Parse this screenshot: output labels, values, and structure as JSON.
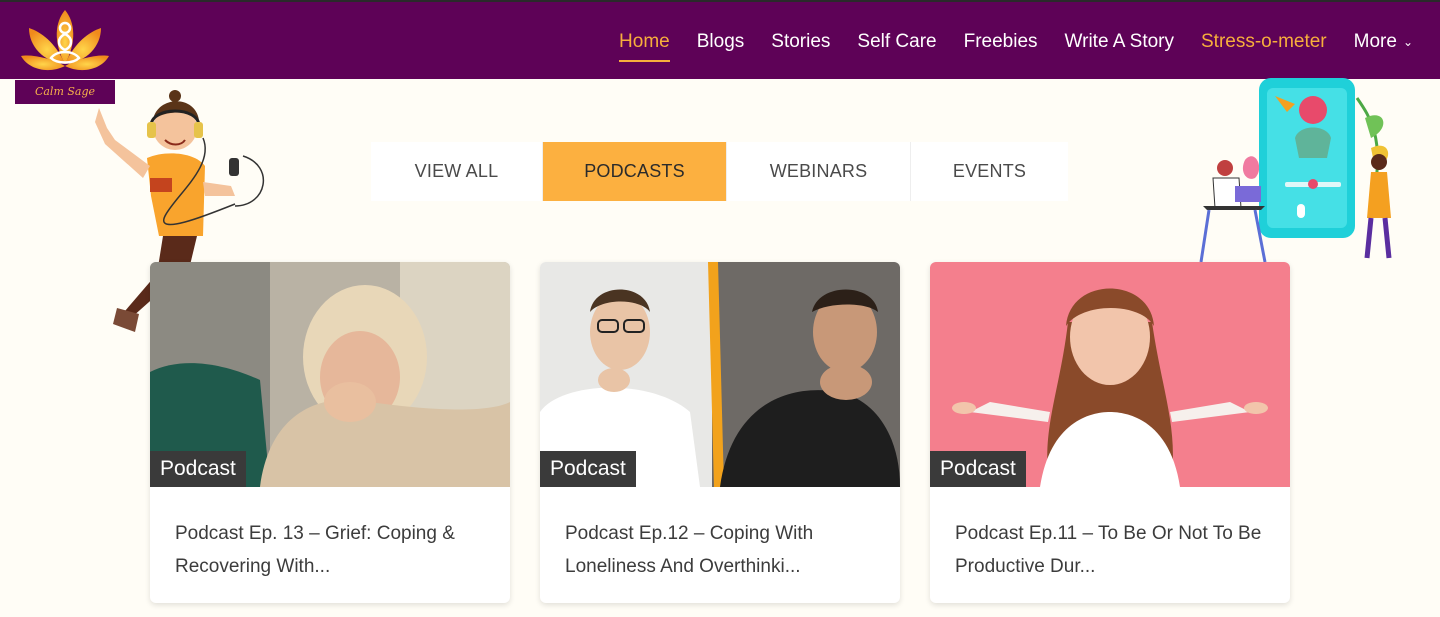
{
  "brand": {
    "name": "Calm Sage"
  },
  "nav": {
    "items": [
      {
        "label": "Home",
        "state": "active"
      },
      {
        "label": "Blogs",
        "state": ""
      },
      {
        "label": "Stories",
        "state": ""
      },
      {
        "label": "Self Care",
        "state": ""
      },
      {
        "label": "Freebies",
        "state": ""
      },
      {
        "label": "Write A Story",
        "state": ""
      },
      {
        "label": "Stress-o-meter",
        "state": "highlight"
      },
      {
        "label": "More",
        "state": ""
      }
    ]
  },
  "filter_tabs": {
    "items": [
      {
        "label": "VIEW ALL"
      },
      {
        "label": "PODCASTS"
      },
      {
        "label": "WEBINARS"
      },
      {
        "label": "EVENTS"
      }
    ],
    "selected": "PODCASTS"
  },
  "cards": [
    {
      "badge": "Podcast",
      "title": "Podcast Ep. 13 – Grief: Coping & Recovering With..."
    },
    {
      "badge": "Podcast",
      "title": "Podcast Ep.12 – Coping With Loneliness And Overthinki..."
    },
    {
      "badge": "Podcast",
      "title": "Podcast Ep.11 – To Be Or Not To Be Productive Dur..."
    }
  ],
  "icons": {
    "logo": "lotus-meditation-icon",
    "more": "chevron-down-icon"
  },
  "colors": {
    "nav_bg": "#5e0257",
    "accent": "#fcb040",
    "page_bg": "#fffdf6"
  }
}
